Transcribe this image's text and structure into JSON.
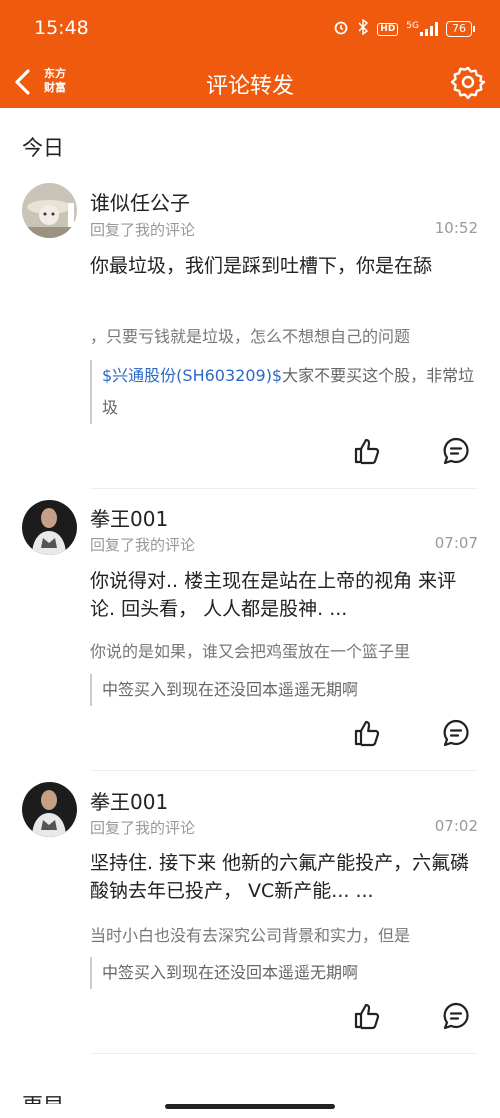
{
  "status_bar": {
    "time": "15:48",
    "network": "5G",
    "battery": "76"
  },
  "nav": {
    "logo_line1": "东方",
    "logo_line2": "财富",
    "title": "评论转发"
  },
  "section": {
    "title": "今日"
  },
  "comments": [
    {
      "user": "谁似任公子",
      "reply_label": "回复了我的评论",
      "time": "10:52",
      "reply_text": "你最垃圾，我们是踩到吐槽下，你是在舔",
      "original_text": "，只要亏钱就是垃圾，怎么不想想自己的问题",
      "quote_link": "$兴通股份(SH603209)$",
      "quote_text": "大家不要买这个股，非常垃圾"
    },
    {
      "user": "拳王001",
      "reply_label": "回复了我的评论",
      "time": "07:07",
      "reply_text": "你说得对.. 楼主现在是站在上帝的视角 来评论. 回头看， 人人都是股神. ...",
      "original_text": "你说的是如果，谁又会把鸡蛋放在一个篮子里",
      "quote_link": "",
      "quote_text": "中签买入到现在还没回本遥遥无期啊"
    },
    {
      "user": "拳王001",
      "reply_label": "回复了我的评论",
      "time": "07:02",
      "reply_text": "坚持住. 接下来  他新的六氟产能投产，六氟磷酸钠去年已投产， VC新产能... ...",
      "original_text": "当时小白也没有去深究公司背景和实力，但是",
      "quote_link": "",
      "quote_text": "中签买入到现在还没回本遥遥无期啊"
    }
  ],
  "next_section": {
    "title": "更早"
  }
}
